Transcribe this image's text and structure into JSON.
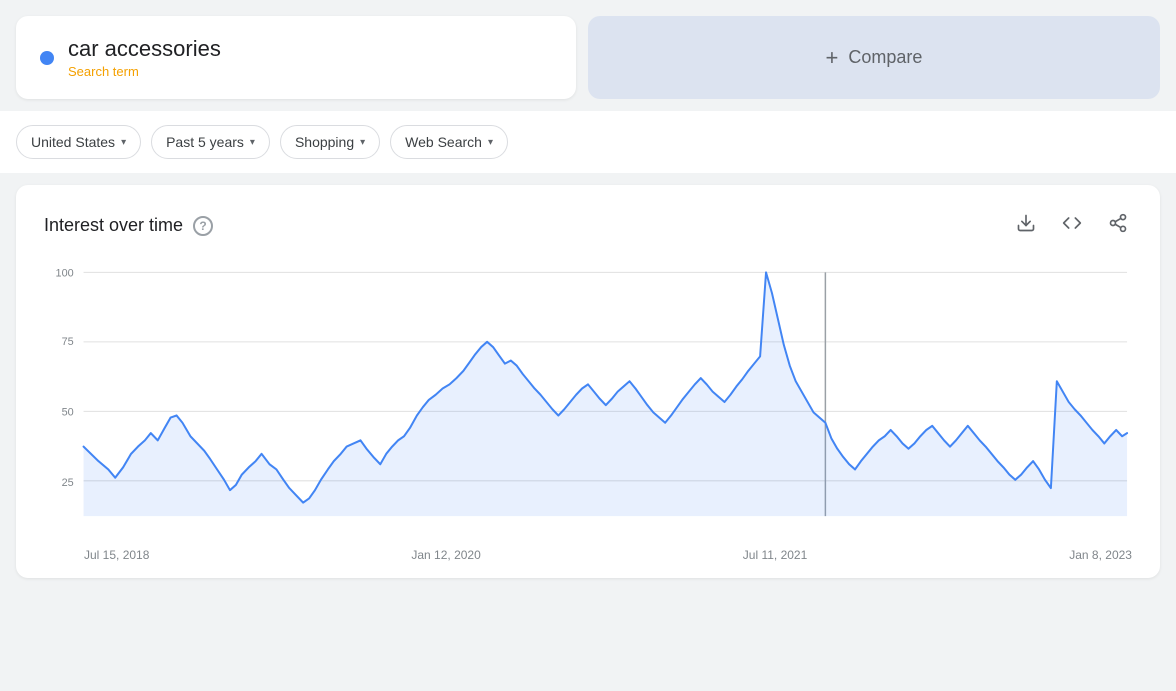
{
  "search_term": {
    "label": "car accessories",
    "sub_label": "Search term",
    "dot_color": "#4285f4"
  },
  "compare": {
    "plus": "+",
    "label": "Compare"
  },
  "filters": [
    {
      "id": "region",
      "label": "United States"
    },
    {
      "id": "time",
      "label": "Past 5 years"
    },
    {
      "id": "category",
      "label": "Shopping"
    },
    {
      "id": "search_type",
      "label": "Web Search"
    }
  ],
  "chart": {
    "title": "Interest over time",
    "help_text": "?",
    "x_labels": [
      "Jul 15, 2018",
      "Jan 12, 2020",
      "Jul 11, 2021",
      "Jan 8, 2023"
    ],
    "y_labels": [
      "100",
      "75",
      "50",
      "25"
    ],
    "download_icon": "⬇",
    "code_icon": "<>",
    "share_icon": "share"
  }
}
